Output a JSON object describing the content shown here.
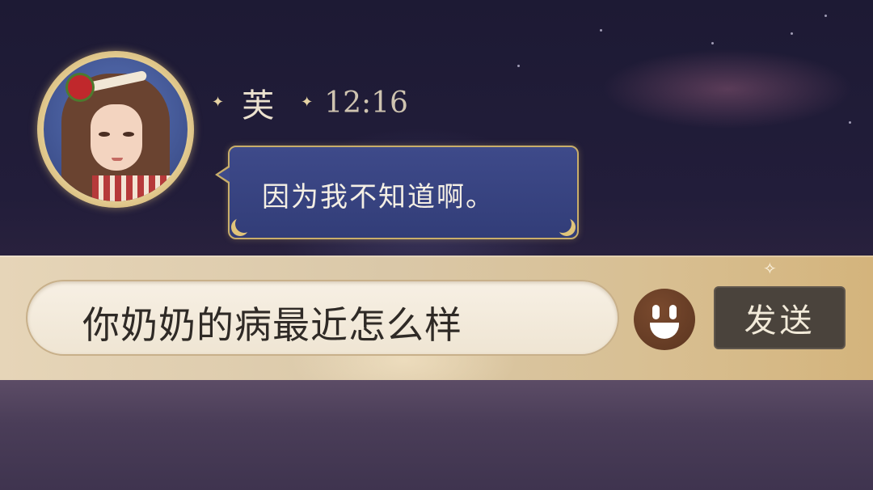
{
  "message": {
    "sender_name": "芙",
    "time": "12:16",
    "text": "因为我不知道啊。"
  },
  "input_bar": {
    "value": "你奶奶的病最近怎么样",
    "emoji_icon": "smiley-face-icon",
    "send_label": "发送"
  },
  "colors": {
    "bubble_bg": "#3a4584",
    "bubble_border": "#c9ae6a",
    "input_bar_bg": "#dcc9a6",
    "send_button_bg": "#4a433c",
    "emoji_button_bg": "#6b3f27"
  }
}
